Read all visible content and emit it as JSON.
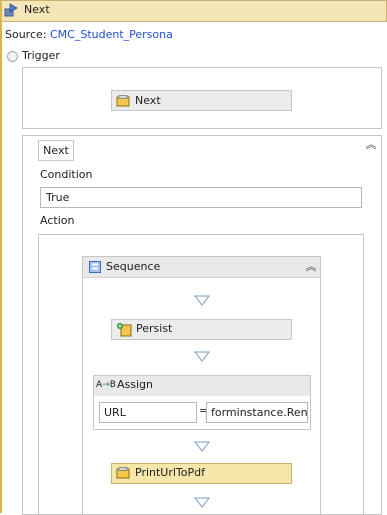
{
  "header": {
    "title": "Next",
    "icon": "workflow-arrow-icon"
  },
  "source": {
    "label": "Source:",
    "value": "CMC_Student_Persona"
  },
  "trigger": {
    "label": "Trigger",
    "activity_label": "Next",
    "activity_icon": "activity-icon"
  },
  "rule": {
    "tab_label": "Next",
    "condition_label": "Condition",
    "condition_value": "True",
    "action_label": "Action"
  },
  "sequence": {
    "label": "Sequence",
    "icon": "sequence-icon",
    "activities": [
      {
        "label": "Persist",
        "icon": "persist-icon"
      },
      {
        "label": "Assign",
        "icon": "assign-icon",
        "to": "URL",
        "operator": "=",
        "value": "forminstance.Rend"
      },
      {
        "label": "PrintUrlToPdf",
        "icon": "activity-icon"
      }
    ]
  },
  "colors": {
    "accent": "#e0b24f",
    "link": "#1f4fd0",
    "selected_activity": "#f7e6a9"
  }
}
